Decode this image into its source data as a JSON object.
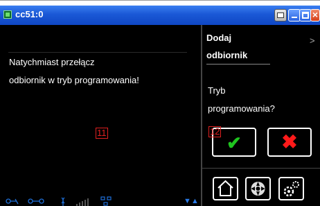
{
  "window": {
    "title": "cc51:0"
  },
  "left": {
    "message_line1": "Natychmiast przełącz",
    "message_line2": "odbiornik w tryb programowania!",
    "annotation": "11"
  },
  "right": {
    "title_line1": "Dodaj",
    "title_line2": "odbiornik",
    "question_line1": "Tryb",
    "question_line2": "programowania?",
    "annotation": "12",
    "ok_glyph": "✔",
    "cancel_glyph": "✖"
  },
  "colors": {
    "titlebar": "#1a58d6",
    "ok": "#1fc41f",
    "cancel": "#ff1a1a",
    "status_icons": "#1e6fd8",
    "annotation": "#e02020"
  },
  "icons": [
    "app-icon",
    "print-icon",
    "minimize-icon",
    "maximize-icon",
    "close-icon",
    "chevron-icon",
    "home-icon",
    "radio-icon",
    "settings-icon",
    "status-icons"
  ]
}
